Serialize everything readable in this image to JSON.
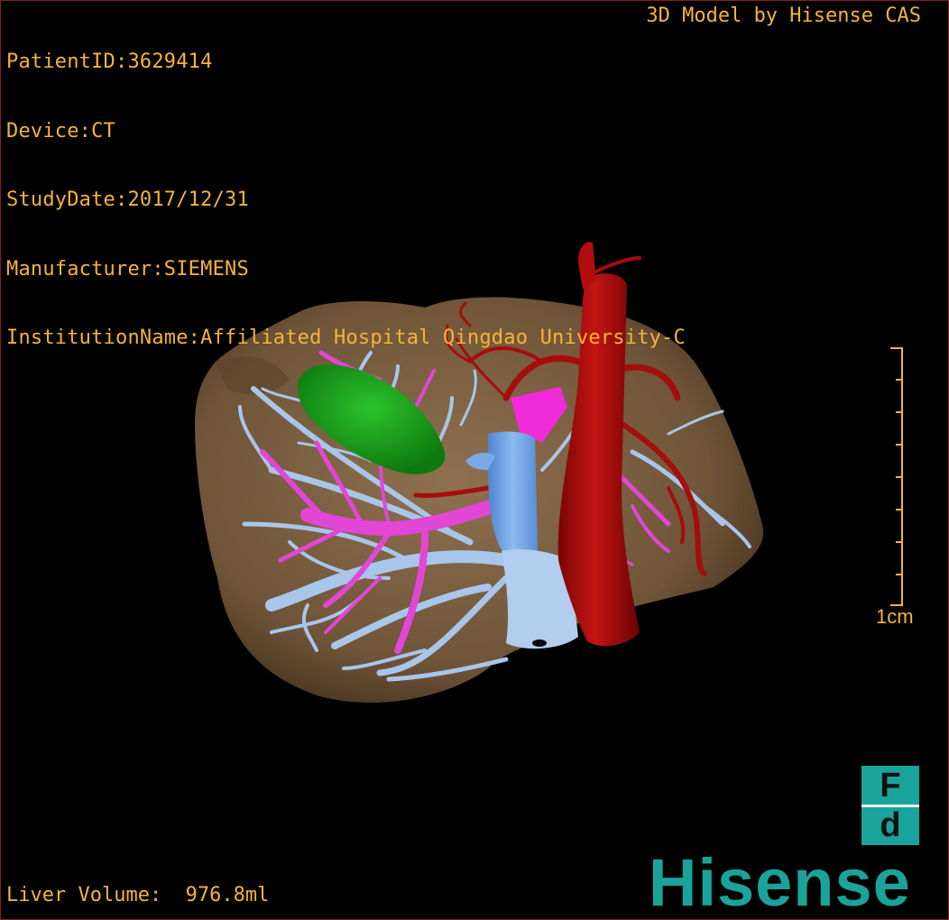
{
  "header": {
    "patient_id": "PatientID:3629414",
    "device": "Device:CT",
    "study_date": "StudyDate:2017/12/31",
    "manufacturer": "Manufacturer:SIEMENS",
    "institution": "InstitutionName:Affiliated Hospital Qingdao University-C"
  },
  "credit": "3D Model by Hisense CAS",
  "measurements": {
    "liver_volume": "Liver Volume:  976.8ml"
  },
  "scale_bar": {
    "label": "1cm"
  },
  "logo": {
    "box_top": "F",
    "box_bottom": "d",
    "brand": "Hisense"
  },
  "colors": {
    "overlay_text": "#f5b435",
    "liver": "#7e6244",
    "gallbladder": "#1ea11e",
    "artery": "#b00a0a",
    "portal_vein": "#e63ad8",
    "hepatic_vein": "#9ec0e8",
    "ivc": "#6aa2e4",
    "brand": "#1aa39a"
  }
}
